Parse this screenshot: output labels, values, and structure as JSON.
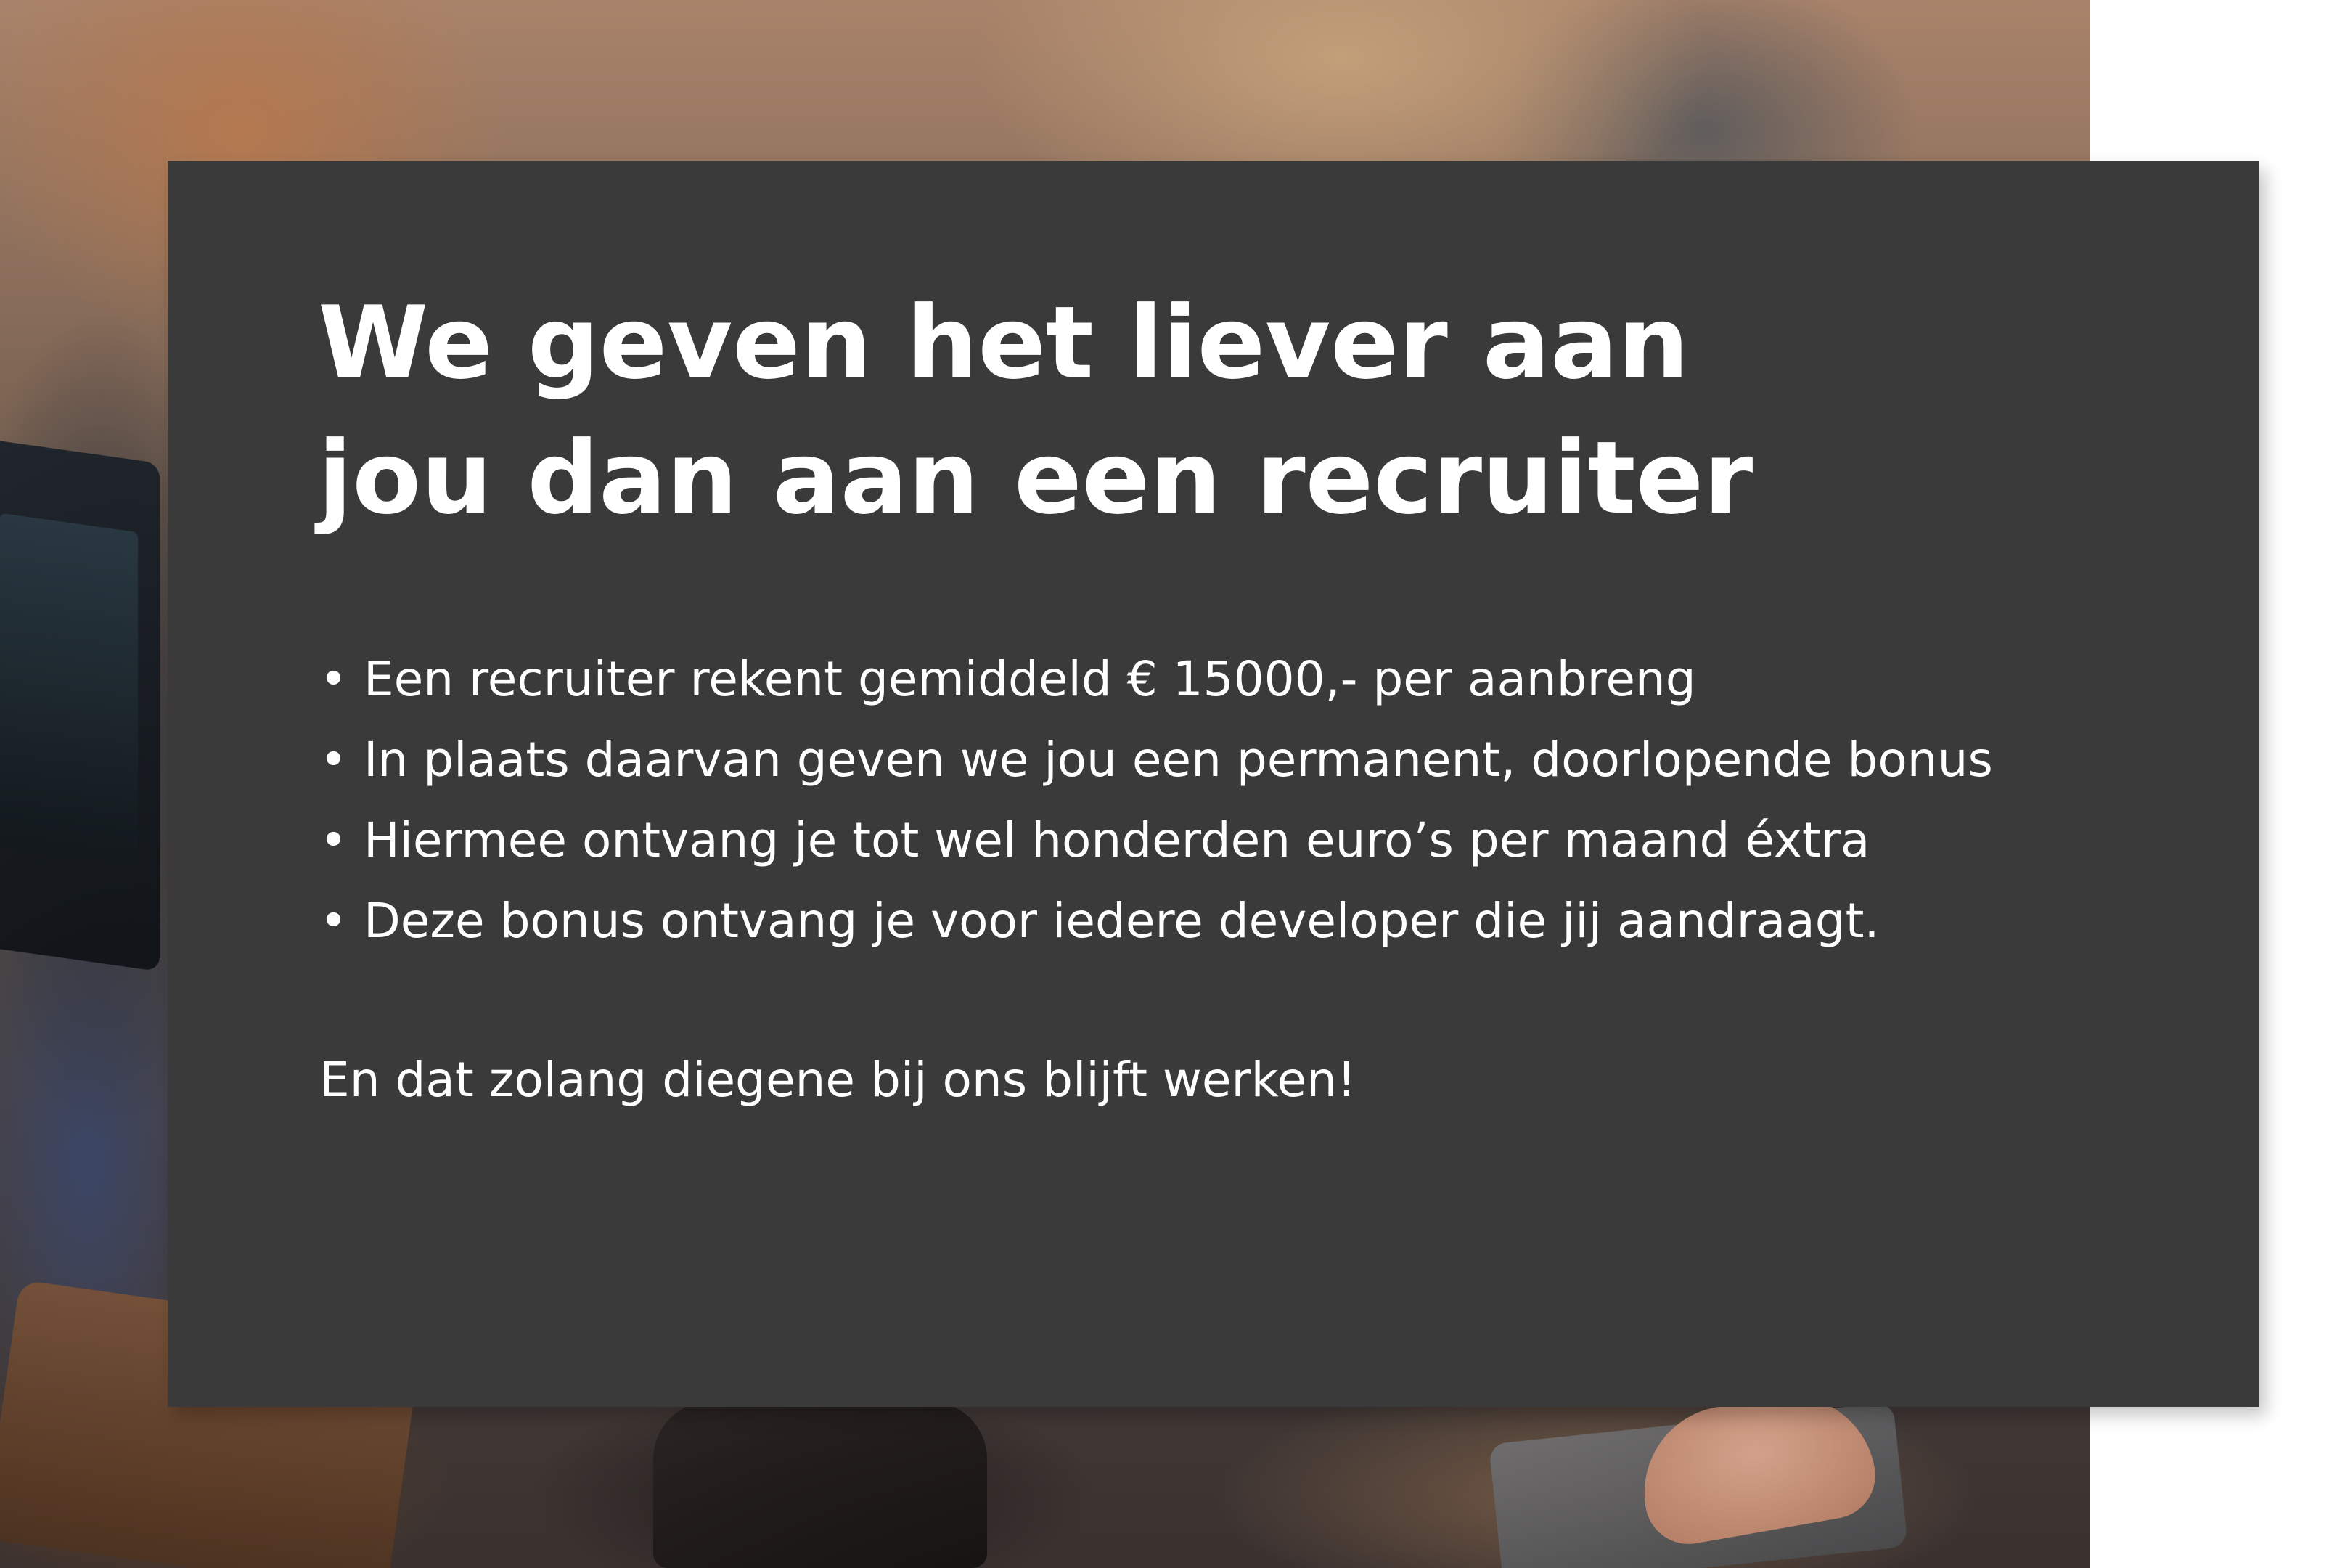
{
  "headline": {
    "line1": "We geven het liever aan",
    "line2": "jou dan aan een recruiter"
  },
  "bullets": {
    "marker": "•",
    "items": [
      "Een recruiter rekent gemiddeld € 15000,- per aanbreng",
      "In plaats daarvan geven we jou een permanent, doorlopende bonus",
      "Hiermee ontvang je tot wel honderden euro’s per maand éxtra",
      "Deze bonus ontvang je voor iedere developer die jij aandraagt."
    ]
  },
  "closing": "En dat zolang diegene bij ons blijft werken!",
  "colors": {
    "card_background": "#3a3a3a",
    "text": "#ffffff",
    "page_background": "#ffffff"
  }
}
